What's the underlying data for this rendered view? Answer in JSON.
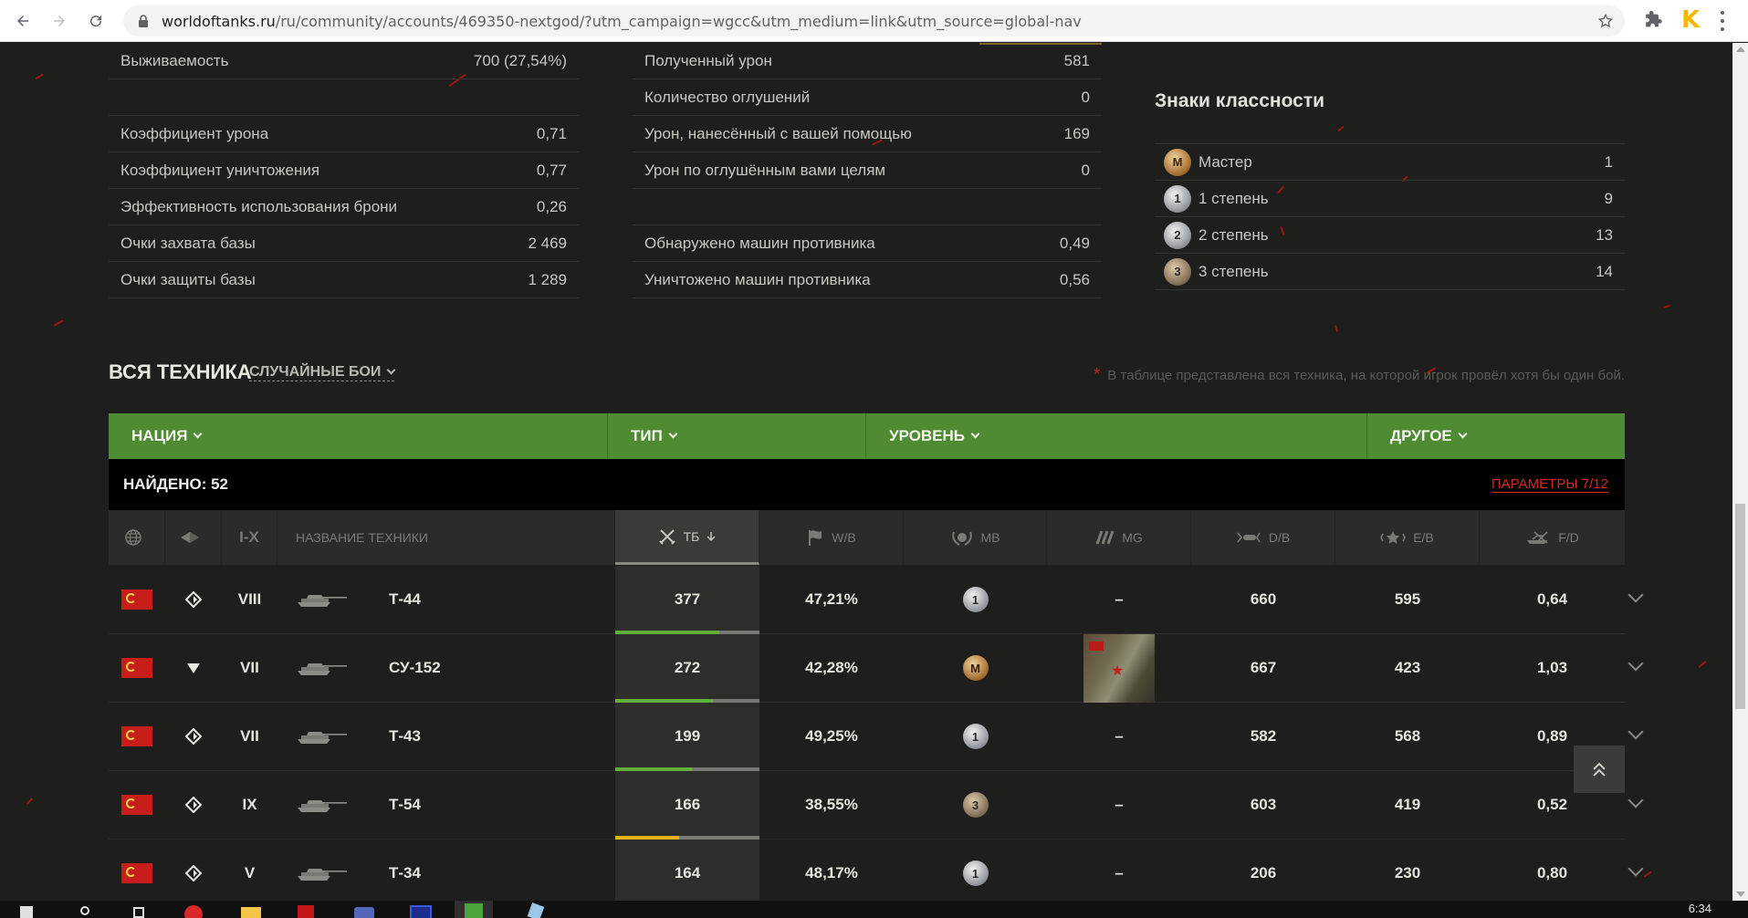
{
  "browser": {
    "url_host": "worldoftanks.ru",
    "url_path": "/ru/community/accounts/469350-nextgod/?utm_campaign=wgcc&utm_medium=link&utm_source=global-nav",
    "ext_letter": "K"
  },
  "stats_left": [
    {
      "label": "Выживаемость",
      "value": "700 (27,54%)"
    },
    {
      "label": "",
      "value": ""
    },
    {
      "label": "Коэффициент урона",
      "value": "0,71"
    },
    {
      "label": "Коэффициент уничтожения",
      "value": "0,77"
    },
    {
      "label": "Эффективность использования брони",
      "value": "0,26"
    },
    {
      "label": "Очки захвата базы",
      "value": "2 469"
    },
    {
      "label": "Очки защиты базы",
      "value": "1 289"
    }
  ],
  "stats_mid": [
    {
      "label": "Полученный урон",
      "value": "581"
    },
    {
      "label": "Количество оглушений",
      "value": "0"
    },
    {
      "label": "Урон, нанесённый с вашей помощью",
      "value": "169"
    },
    {
      "label": "Урон по оглушённым вами целям",
      "value": "0"
    },
    {
      "label": "",
      "value": ""
    },
    {
      "label": "Обнаружено машин противника",
      "value": "0,49"
    },
    {
      "label": "Уничтожено машин противника",
      "value": "0,56"
    }
  ],
  "mastery": {
    "title": "Знаки классности",
    "items": [
      {
        "badge": "M",
        "tone": "gold",
        "label": "Мастер",
        "value": "1"
      },
      {
        "badge": "1",
        "tone": "silver",
        "label": "1 степень",
        "value": "9"
      },
      {
        "badge": "2",
        "tone": "silver",
        "label": "2 степень",
        "value": "13"
      },
      {
        "badge": "3",
        "tone": "bronze",
        "label": "3 степень",
        "value": "14"
      }
    ]
  },
  "vehicles": {
    "title": "ВСЯ ТЕХНИКА",
    "mode": "СЛУЧАЙНЫЕ БОИ",
    "note_mark": "*",
    "note": "В таблице представлена вся техника, на которой игрок провёл хотя бы один бой.",
    "filters": [
      "НАЦИЯ",
      "ТИП",
      "УРОВЕНЬ",
      "ДРУГОЕ"
    ],
    "found": "НАЙДЕНО: 52",
    "params": "ПАРАМЕТРЫ 7/12",
    "columns": {
      "tier": "I-X",
      "name": "НАЗВАНИЕ ТЕХНИКИ",
      "tb": "ТБ",
      "wb": "W/B",
      "mb": "MB",
      "mg": "MG",
      "db": "D/B",
      "eb": "E/B",
      "fd": "F/D"
    },
    "rows": [
      {
        "type": "mt",
        "tier": "VIII",
        "name": "Т-44",
        "tb": "377",
        "tb_fill": 0.72,
        "tb_color": "#62b03a",
        "wb": "47,21%",
        "mb": "1",
        "mb_tone": "silver",
        "mg": "–",
        "db": "660",
        "eb": "595",
        "fd": "0,64"
      },
      {
        "type": "td",
        "tier": "VII",
        "name": "СУ-152",
        "tb": "272",
        "tb_fill": 0.68,
        "tb_color": "#62b03a",
        "wb": "42,28%",
        "mb": "M",
        "mb_tone": "gold",
        "mg": "",
        "db": "667",
        "eb": "423",
        "fd": "1,03"
      },
      {
        "type": "mt",
        "tier": "VII",
        "name": "Т-43",
        "tb": "199",
        "tb_fill": 0.53,
        "tb_color": "#62b03a",
        "wb": "49,25%",
        "mb": "1",
        "mb_tone": "silver",
        "mg": "–",
        "db": "582",
        "eb": "568",
        "fd": "0,89"
      },
      {
        "type": "mt",
        "tier": "IX",
        "name": "Т-54",
        "tb": "166",
        "tb_fill": 0.44,
        "tb_color": "#e8b317",
        "wb": "38,55%",
        "mb": "3",
        "mb_tone": "bronze",
        "mg": "–",
        "db": "603",
        "eb": "419",
        "fd": "0,52"
      },
      {
        "type": "mt",
        "tier": "V",
        "name": "Т-34",
        "tb": "164",
        "tb_fill": 0.43,
        "tb_color": "#62b03a",
        "wb": "48,17%",
        "mb": "1",
        "mb_tone": "silver",
        "mg": "–",
        "db": "206",
        "eb": "230",
        "fd": "0,80"
      }
    ]
  },
  "taskbar": {
    "clock": "6:34"
  }
}
